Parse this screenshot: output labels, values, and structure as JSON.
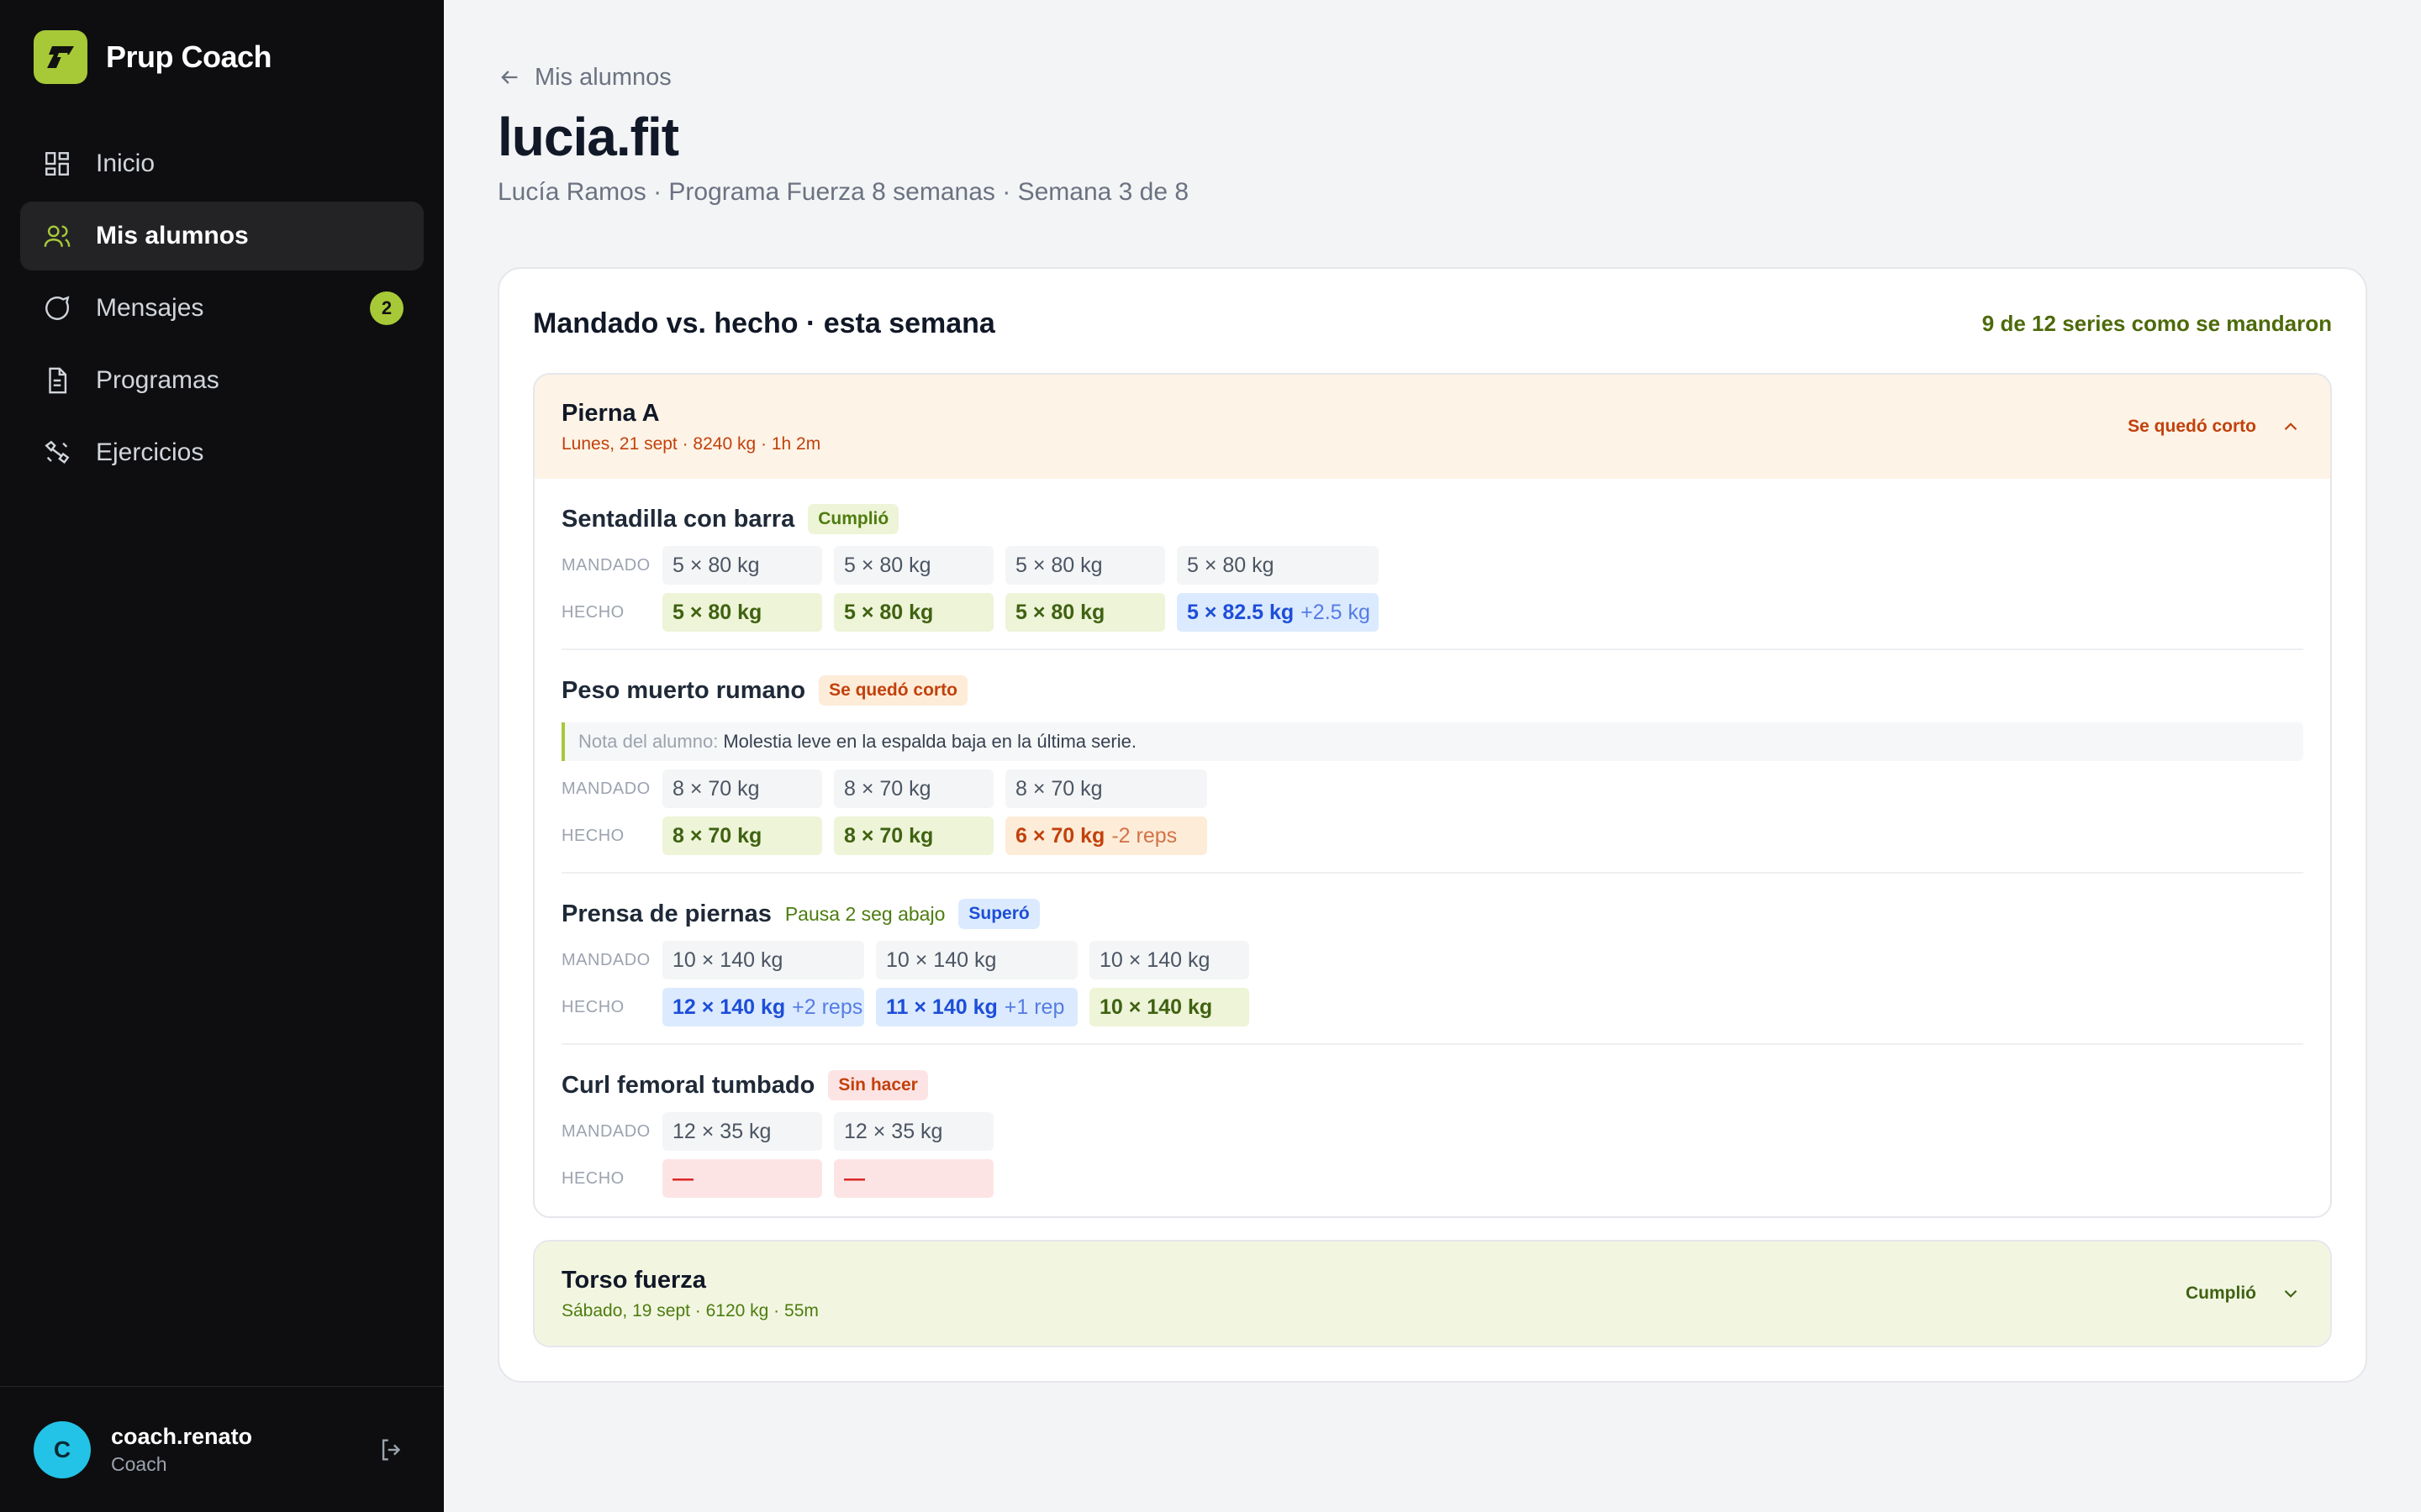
{
  "app": {
    "name": "Prup Coach"
  },
  "sidebar": {
    "items": [
      {
        "label": "Inicio",
        "icon": "grid-icon",
        "active": false
      },
      {
        "label": "Mis alumnos",
        "icon": "users-icon",
        "active": true
      },
      {
        "label": "Mensajes",
        "icon": "chat-icon",
        "active": false,
        "badge": "2"
      },
      {
        "label": "Programas",
        "icon": "document-icon",
        "active": false
      },
      {
        "label": "Ejercicios",
        "icon": "dumbbell-icon",
        "active": false
      }
    ],
    "user": {
      "initial": "C",
      "name": "coach.renato",
      "role": "Coach"
    }
  },
  "header": {
    "back_label": "Mis alumnos",
    "title": "lucia.fit",
    "subtitle": "Lucía Ramos · Programa Fuerza 8 semanas · Semana 3 de 8"
  },
  "card": {
    "title": "Mandado vs. hecho · esta semana",
    "summary": "9 de 12 series como se mandaron"
  },
  "labels": {
    "planned": "MANDADO",
    "done": "HECHO"
  },
  "sessions": [
    {
      "name": "Pierna A",
      "meta": "Lunes, 21 sept · 8240 kg · 1h 2m",
      "status": "Se quedó corto",
      "expanded": true,
      "exercises": [
        {
          "name": "Sentadilla con barra",
          "tag": "Cumplió",
          "planned": [
            "5 × 80 kg",
            "5 × 80 kg",
            "5 × 80 kg",
            "5 × 80 kg"
          ],
          "done": [
            {
              "value": "5 × 80 kg",
              "delta": ""
            },
            {
              "value": "5 × 80 kg",
              "delta": ""
            },
            {
              "value": "5 × 80 kg",
              "delta": ""
            },
            {
              "value": "5 × 82.5 kg",
              "delta": "+2.5 kg"
            }
          ]
        },
        {
          "name": "Peso muerto rumano",
          "tag": "Se quedó corto",
          "note_label": "Nota del alumno:",
          "note": "Molestia leve en la espalda baja en la última serie.",
          "planned": [
            "8 × 70 kg",
            "8 × 70 kg",
            "8 × 70 kg"
          ],
          "done": [
            {
              "value": "8 × 70 kg",
              "delta": ""
            },
            {
              "value": "8 × 70 kg",
              "delta": ""
            },
            {
              "value": "6 × 70 kg",
              "delta": "-2 reps"
            }
          ]
        },
        {
          "name": "Prensa de piernas",
          "cue": "Pausa 2 seg abajo",
          "tag": "Superó",
          "planned": [
            "10 × 140 kg",
            "10 × 140 kg",
            "10 × 140 kg"
          ],
          "done": [
            {
              "value": "12 × 140 kg",
              "delta": "+2 reps"
            },
            {
              "value": "11 × 140 kg",
              "delta": "+1 rep"
            },
            {
              "value": "10 × 140 kg",
              "delta": ""
            }
          ]
        },
        {
          "name": "Curl femoral tumbado",
          "tag": "Sin hacer",
          "planned": [
            "12 × 35 kg",
            "12 × 35 kg"
          ],
          "done": [
            {
              "value": "—",
              "delta": ""
            },
            {
              "value": "—",
              "delta": ""
            }
          ]
        }
      ]
    },
    {
      "name": "Torso fuerza",
      "meta": "Sábado, 19 sept · 6120 kg · 55m",
      "status": "Cumplió",
      "expanded": false
    }
  ],
  "colors": {
    "accent": "#a7c938",
    "sidebar_bg": "#0e0e10",
    "ok": "#4d7c0f",
    "short": "#c2410c",
    "over": "#1d4ed8",
    "missed": "#dc2626"
  }
}
